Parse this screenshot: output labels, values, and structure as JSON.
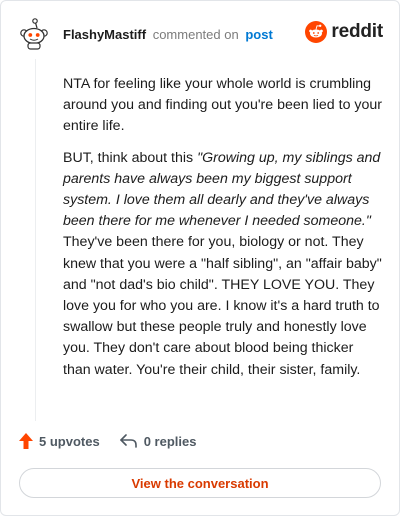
{
  "comment": {
    "username": "FlashyMastiff",
    "action": "commented on",
    "target": "post",
    "body": {
      "p1": "NTA for feeling like your whole world is crumbling around you and finding out you're been lied to your entire life.",
      "p2_lead": "BUT, think about this ",
      "p2_quote": "\"Growing up, my siblings and parents have always been my biggest support system. I love them all dearly and they've always been there for me whenever I needed someone.\"",
      "p2_rest": " They've been there for you, biology or not. They knew that you were a \"half sibling\", an \"affair baby\" and \"not dad's bio child\". THEY LOVE YOU. They love you for who you are. I know it's a hard truth to swallow but these people truly and honestly love you. They don't care about blood being thicker than water. You're their child, their sister, family."
    }
  },
  "brand": {
    "name": "reddit",
    "icon": "reddit-logo-icon",
    "color": "#ff4500"
  },
  "avatar": {
    "icon": "snoo-avatar-icon"
  },
  "footer": {
    "upvotes": "5 upvotes",
    "replies": "0 replies",
    "upvote_icon": "upvote-arrow-icon",
    "reply_icon": "reply-arrow-icon",
    "upvote_color": "#ff4500"
  },
  "cta": {
    "label": "View the conversation",
    "color": "#d93a00"
  }
}
